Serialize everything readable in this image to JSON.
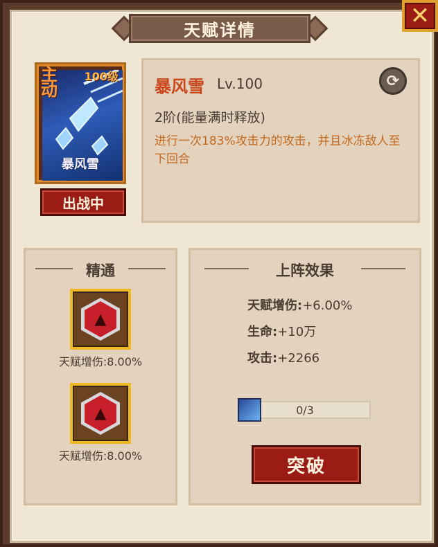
{
  "header": {
    "title": "天赋详情"
  },
  "skill_card": {
    "type_label": "主动",
    "level_label": "100级",
    "name": "暴风雪",
    "deploy_label": "出战中"
  },
  "skill_info": {
    "name": "暴风雪",
    "level": "Lv.100",
    "stage": "2阶(能量满时释放)",
    "description": "进行一次183%攻击力的攻击，并且冰冻敌人至下回合"
  },
  "mastery": {
    "heading": "精通",
    "items": [
      {
        "label": "天赋增伤:8.00%"
      },
      {
        "label": "天赋增伤:8.00%"
      }
    ]
  },
  "effect": {
    "heading": "上阵效果",
    "stats": [
      {
        "label": "天赋增伤:",
        "value": "+6.00%"
      },
      {
        "label": "生命:",
        "value": "+10万"
      },
      {
        "label": "攻击:",
        "value": "+2266"
      }
    ],
    "progress": {
      "text": "0/3",
      "current": 0,
      "max": 3
    },
    "break_label": "突破"
  },
  "colors": {
    "accent_red": "#9a1c14",
    "skill_name": "#c8481a",
    "description": "#c46a1e",
    "gold_border": "#f0b820"
  }
}
